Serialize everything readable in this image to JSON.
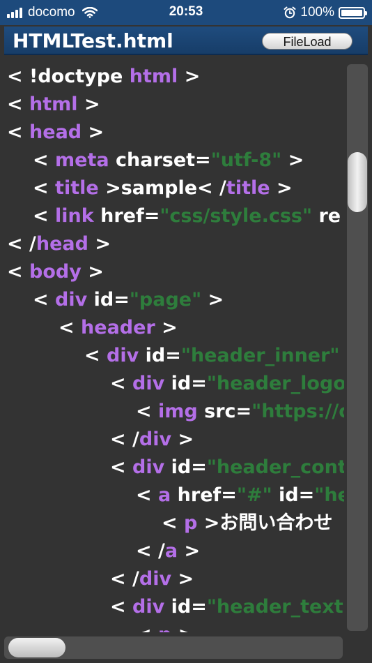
{
  "status_bar": {
    "carrier": "docomo",
    "time": "20:53",
    "battery_percent": "100%",
    "signal_icon": "signal-bars-icon",
    "wifi_icon": "wifi-icon",
    "alarm_icon": "alarm-clock-icon",
    "battery_icon": "battery-icon"
  },
  "header": {
    "file_name": "HTMLTest.html",
    "file_load_label": "FileLoad"
  },
  "colors": {
    "tag": "#b46fe8",
    "string": "#2e7d3c",
    "text": "#ffffff",
    "background": "#333333",
    "title_bar": "#1d4a7c"
  },
  "code": {
    "lines": [
      {
        "indent": 0,
        "tokens": [
          {
            "t": "txt",
            "v": "< !doctype "
          },
          {
            "t": "tag",
            "v": "html"
          },
          {
            "t": "txt",
            "v": " >"
          }
        ]
      },
      {
        "indent": 0,
        "tokens": [
          {
            "t": "txt",
            "v": "< "
          },
          {
            "t": "tag",
            "v": "html"
          },
          {
            "t": "txt",
            "v": " >"
          }
        ]
      },
      {
        "indent": 0,
        "tokens": [
          {
            "t": "txt",
            "v": "< "
          },
          {
            "t": "tag",
            "v": "head"
          },
          {
            "t": "txt",
            "v": " >"
          }
        ]
      },
      {
        "indent": 1,
        "tokens": [
          {
            "t": "txt",
            "v": "< "
          },
          {
            "t": "tag",
            "v": "meta"
          },
          {
            "t": "txt",
            "v": " charset="
          },
          {
            "t": "str",
            "v": "\"utf-8\""
          },
          {
            "t": "txt",
            "v": " >"
          }
        ]
      },
      {
        "indent": 1,
        "tokens": [
          {
            "t": "txt",
            "v": "< "
          },
          {
            "t": "tag",
            "v": "title"
          },
          {
            "t": "txt",
            "v": " >sample< /"
          },
          {
            "t": "tag",
            "v": "title"
          },
          {
            "t": "txt",
            "v": " >"
          }
        ]
      },
      {
        "indent": 1,
        "tokens": [
          {
            "t": "txt",
            "v": "< "
          },
          {
            "t": "tag",
            "v": "link"
          },
          {
            "t": "txt",
            "v": " href="
          },
          {
            "t": "str",
            "v": "\"css/style.css\""
          },
          {
            "t": "txt",
            "v": " re"
          }
        ]
      },
      {
        "indent": 0,
        "tokens": [
          {
            "t": "txt",
            "v": "< /"
          },
          {
            "t": "tag",
            "v": "head"
          },
          {
            "t": "txt",
            "v": " >"
          }
        ]
      },
      {
        "indent": 0,
        "tokens": [
          {
            "t": "txt",
            "v": "< "
          },
          {
            "t": "tag",
            "v": "body"
          },
          {
            "t": "txt",
            "v": " >"
          }
        ]
      },
      {
        "indent": 1,
        "tokens": [
          {
            "t": "txt",
            "v": "< "
          },
          {
            "t": "tag",
            "v": "div"
          },
          {
            "t": "txt",
            "v": " id="
          },
          {
            "t": "str",
            "v": "\"page\""
          },
          {
            "t": "txt",
            "v": " >"
          }
        ]
      },
      {
        "indent": 2,
        "tokens": [
          {
            "t": "txt",
            "v": "< "
          },
          {
            "t": "tag",
            "v": "header"
          },
          {
            "t": "txt",
            "v": " >"
          }
        ]
      },
      {
        "indent": 3,
        "tokens": [
          {
            "t": "txt",
            "v": "< "
          },
          {
            "t": "tag",
            "v": "div"
          },
          {
            "t": "txt",
            "v": " id="
          },
          {
            "t": "str",
            "v": "\"header_inner\""
          }
        ]
      },
      {
        "indent": 4,
        "tokens": [
          {
            "t": "txt",
            "v": "< "
          },
          {
            "t": "tag",
            "v": "div"
          },
          {
            "t": "txt",
            "v": " id="
          },
          {
            "t": "str",
            "v": "\"header_logo"
          }
        ]
      },
      {
        "indent": 5,
        "tokens": [
          {
            "t": "txt",
            "v": "< "
          },
          {
            "t": "tag",
            "v": "img"
          },
          {
            "t": "txt",
            "v": " src="
          },
          {
            "t": "str",
            "v": "\"https://c"
          }
        ]
      },
      {
        "indent": 4,
        "tokens": [
          {
            "t": "txt",
            "v": "< /"
          },
          {
            "t": "tag",
            "v": "div"
          },
          {
            "t": "txt",
            "v": " >"
          }
        ]
      },
      {
        "indent": 4,
        "tokens": [
          {
            "t": "txt",
            "v": "< "
          },
          {
            "t": "tag",
            "v": "div"
          },
          {
            "t": "txt",
            "v": " id="
          },
          {
            "t": "str",
            "v": "\"header_cont"
          }
        ]
      },
      {
        "indent": 5,
        "tokens": [
          {
            "t": "txt",
            "v": "< "
          },
          {
            "t": "tag",
            "v": "a"
          },
          {
            "t": "txt",
            "v": " href="
          },
          {
            "t": "str",
            "v": "\"#\""
          },
          {
            "t": "txt",
            "v": " id="
          },
          {
            "t": "str",
            "v": "\"hea"
          }
        ]
      },
      {
        "indent": 6,
        "tokens": [
          {
            "t": "txt",
            "v": "< "
          },
          {
            "t": "tag",
            "v": "p"
          },
          {
            "t": "txt",
            "v": " >お問い合わせ"
          }
        ]
      },
      {
        "indent": 5,
        "tokens": [
          {
            "t": "txt",
            "v": "< /"
          },
          {
            "t": "tag",
            "v": "a"
          },
          {
            "t": "txt",
            "v": " >"
          }
        ]
      },
      {
        "indent": 4,
        "tokens": [
          {
            "t": "txt",
            "v": "< /"
          },
          {
            "t": "tag",
            "v": "div"
          },
          {
            "t": "txt",
            "v": " >"
          }
        ]
      },
      {
        "indent": 4,
        "tokens": [
          {
            "t": "txt",
            "v": "< "
          },
          {
            "t": "tag",
            "v": "div"
          },
          {
            "t": "txt",
            "v": " id="
          },
          {
            "t": "str",
            "v": "\"header_text\""
          }
        ]
      },
      {
        "indent": 5,
        "tokens": [
          {
            "t": "txt",
            "v": "< "
          },
          {
            "t": "tag",
            "v": "p"
          },
          {
            "t": "txt",
            "v": " >"
          }
        ]
      }
    ]
  },
  "scroll": {
    "vertical_position": 0.18,
    "horizontal_position": 0.0
  }
}
